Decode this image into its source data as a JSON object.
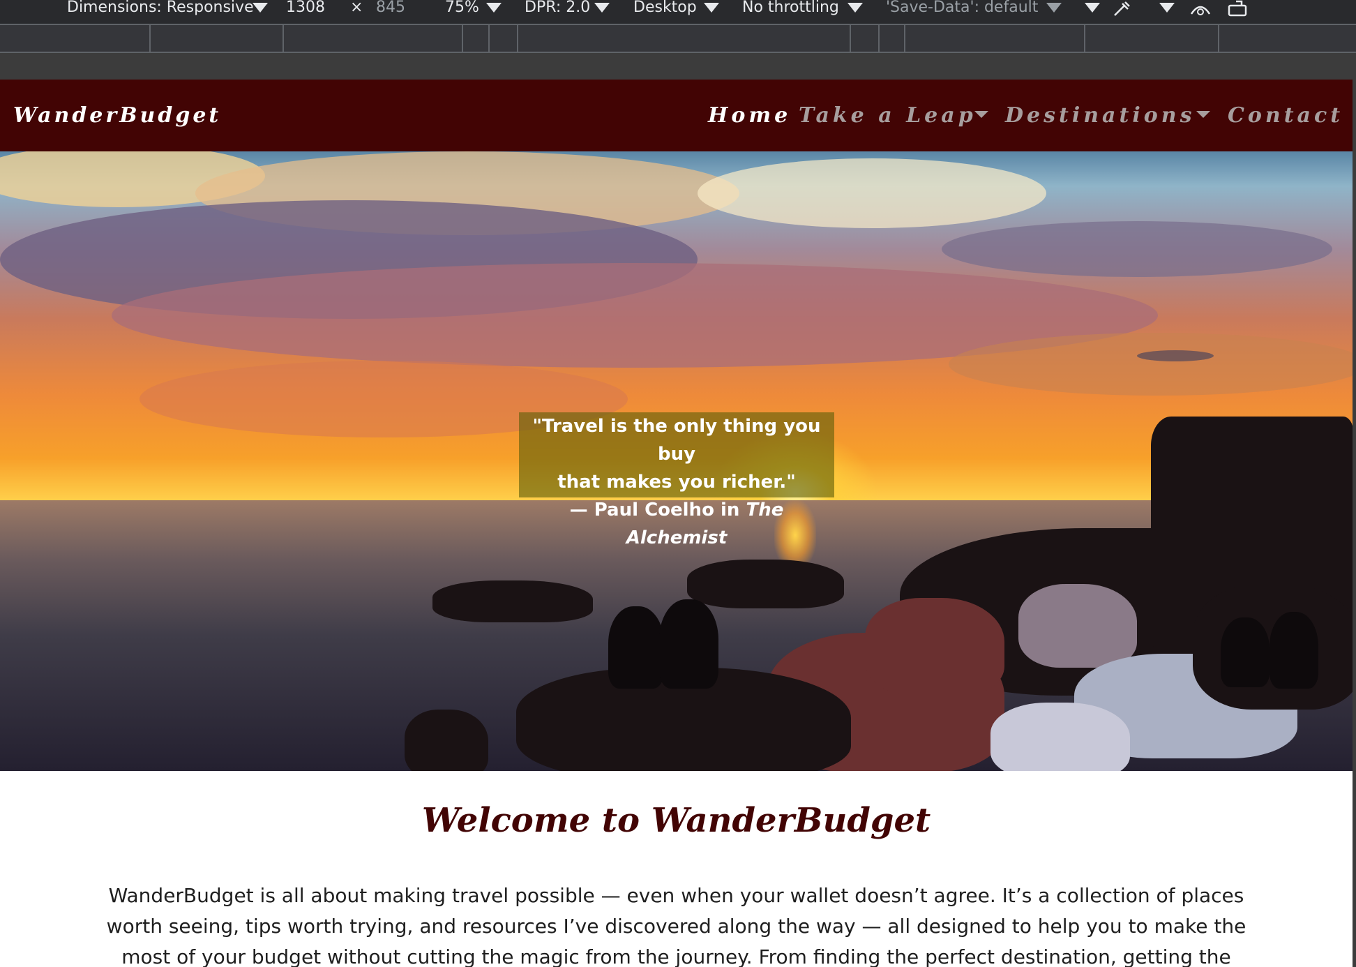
{
  "devtools": {
    "dimensions_label": "Dimensions: Responsive",
    "width": "1308",
    "times": "×",
    "height": "845",
    "zoom": "75%",
    "dpr": "DPR: 2.0",
    "device_type": "Desktop",
    "throttling": "No throttling",
    "save_data": "'Save-Data': default"
  },
  "site": {
    "brand": "WanderBudget",
    "nav": {
      "home": "Home",
      "take_a_leap": "Take a Leap",
      "destinations": "Destinations",
      "contact": "Contact"
    },
    "hero": {
      "quote_line1": "\"Travel is the only thing you buy",
      "quote_line2": "that makes you richer.\"",
      "attribution_prefix": "—  Paul Coelho in ",
      "attribution_book": "The Alchemist"
    },
    "welcome": {
      "title": "Welcome to WanderBudget",
      "body": "WanderBudget is all about making travel possible — even when your wallet doesn’t agree. It’s a collection of places worth seeing, tips worth trying, and resources I’ve discovered along the way — all designed to help you to make the most of your budget without cutting the magic from the journey. From finding the perfect destination, getting the"
    }
  },
  "colors": {
    "navbar": "#420404",
    "nav_inactive": "#a79e9e",
    "title": "#420404"
  }
}
